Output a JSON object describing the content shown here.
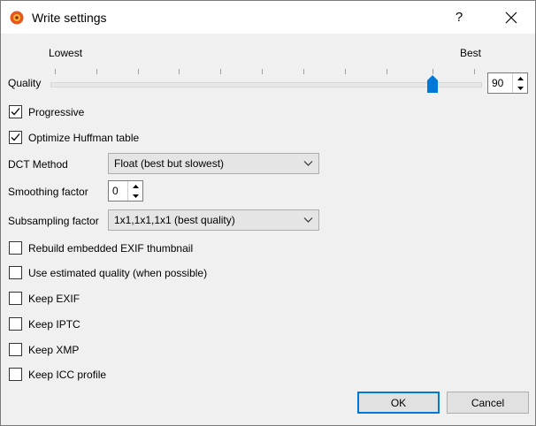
{
  "window": {
    "title": "Write settings",
    "help_label": "?"
  },
  "quality": {
    "label": "Quality",
    "min_label": "Lowest",
    "max_label": "Best",
    "value": "90",
    "level": 90
  },
  "checkboxes": {
    "progressive": {
      "label": "Progressive",
      "checked": true
    },
    "optimize_huffman": {
      "label": "Optimize Huffman table",
      "checked": true
    },
    "rebuild_exif_thumb": {
      "label": "Rebuild embedded EXIF thumbnail",
      "checked": false
    },
    "estimated_quality": {
      "label": "Use estimated quality (when possible)",
      "checked": false
    },
    "keep_exif": {
      "label": "Keep EXIF",
      "checked": false
    },
    "keep_iptc": {
      "label": "Keep IPTC",
      "checked": false
    },
    "keep_xmp": {
      "label": "Keep XMP",
      "checked": false
    },
    "keep_icc": {
      "label": "Keep ICC profile",
      "checked": false
    }
  },
  "dct": {
    "label": "DCT Method",
    "value": "Float (best but slowest)"
  },
  "smoothing": {
    "label": "Smoothing factor",
    "value": "0"
  },
  "subsampling": {
    "label": "Subsampling factor",
    "value": "1x1,1x1,1x1 (best quality)"
  },
  "buttons": {
    "ok": "OK",
    "cancel": "Cancel"
  },
  "colors": {
    "accent": "#0078d7",
    "background": "#f0f0f0"
  }
}
